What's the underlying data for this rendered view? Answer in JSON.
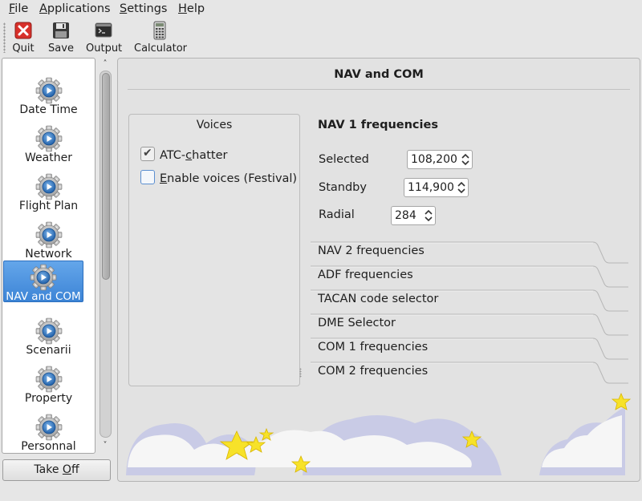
{
  "menubar": {
    "items": [
      {
        "label": "File",
        "mnemonic": "F",
        "rest": "ile"
      },
      {
        "label": "Applications",
        "mnemonic": "A",
        "rest": "pplications"
      },
      {
        "label": "Settings",
        "mnemonic": "S",
        "rest": "ettings"
      },
      {
        "label": "Help",
        "mnemonic": "H",
        "rest": "elp"
      }
    ]
  },
  "toolbar": {
    "quit_label": "Quit",
    "save_label": "Save",
    "output_label": "Output",
    "calculator_label": "Calculator"
  },
  "sidebar": {
    "items": [
      {
        "label": "Date Time",
        "icon": "gear-icon"
      },
      {
        "label": "Weather",
        "icon": "gear-icon"
      },
      {
        "label": "Flight Plan",
        "icon": "gear-icon"
      },
      {
        "label": "Network",
        "icon": "gear-icon"
      },
      {
        "label": "NAV and COM",
        "icon": "gear-icon",
        "selected": true
      },
      {
        "label": "Scenarii",
        "icon": "gear-icon"
      },
      {
        "label": "Property",
        "icon": "gear-icon"
      },
      {
        "label": "Personnal",
        "icon": "gear-icon"
      }
    ],
    "selection_color": "#4a90e2"
  },
  "takeoff": {
    "label_pre": "Take ",
    "mnemonic": "O",
    "label_post": "ff"
  },
  "main": {
    "title": "NAV and COM",
    "voices": {
      "title": "Voices",
      "atc_chatter": {
        "pre": "ATC-",
        "mnemonic": "c",
        "post": "hatter",
        "checked": true
      },
      "enable_voices": {
        "pre": "",
        "mnemonic": "E",
        "post": "nable voices (Festival)",
        "checked": false
      }
    },
    "nav1": {
      "heading": "NAV 1 frequencies",
      "selected_label": "Selected",
      "selected_value": "108,200",
      "standby_label": "Standby",
      "standby_value": "114,900",
      "radial_label": "Radial",
      "radial_value": "284"
    },
    "sections": [
      {
        "label": "NAV 2 frequencies"
      },
      {
        "label": "ADF frequencies"
      },
      {
        "label": "TACAN code selector"
      },
      {
        "label": "DME Selector"
      },
      {
        "label": "COM 1 frequencies"
      },
      {
        "label": "COM 2 frequencies"
      }
    ]
  },
  "colors": {
    "accent": "#4a90e2",
    "cloud": "#f6f6f6",
    "cloud_shadow": "#c9cbe6",
    "star": "#f7e229"
  }
}
